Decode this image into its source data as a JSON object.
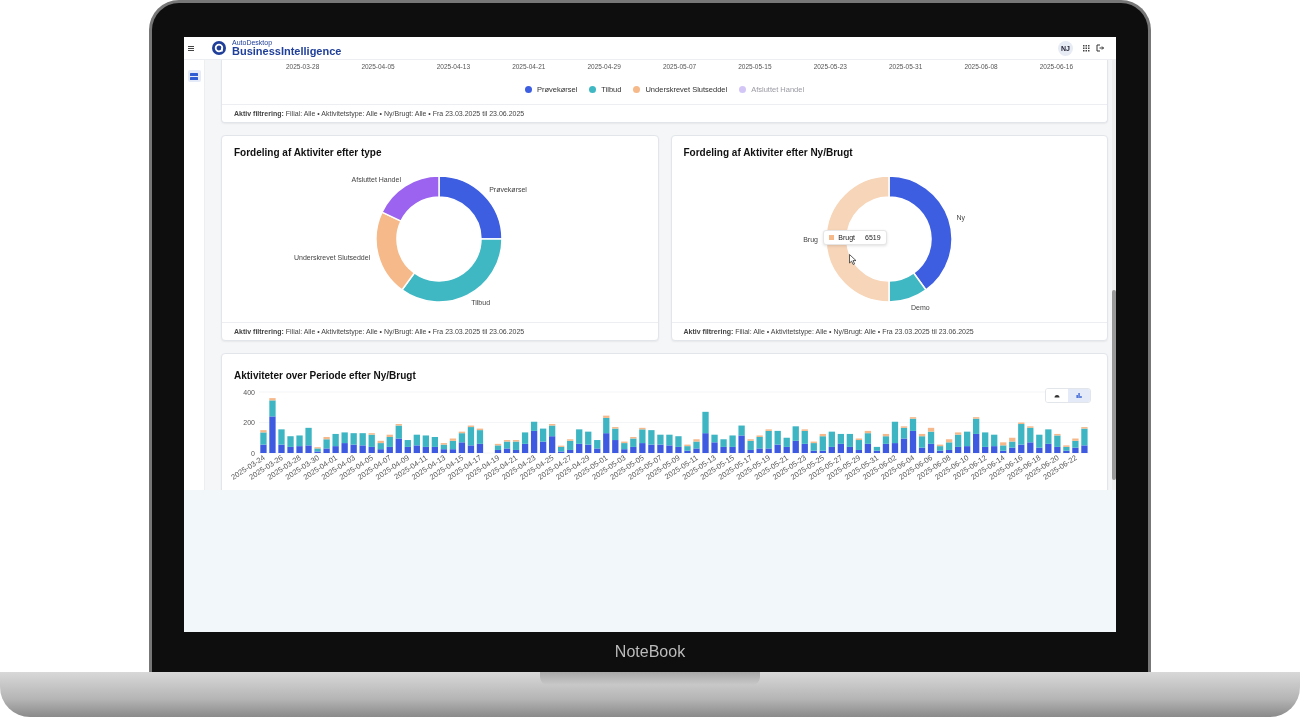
{
  "device": {
    "brand": "NoteBook"
  },
  "header": {
    "app_subtitle": "AutoDesktop",
    "app_title": "BusinessIntelligence",
    "user_initials": "NJ"
  },
  "sidebar": {
    "items": [
      {
        "kind": "dashboard",
        "selected": true
      }
    ]
  },
  "timeline_card": {
    "axis_labels": [
      "2025-03-28",
      "2025-04-05",
      "2025-04-13",
      "2025-04-21",
      "2025-04-29",
      "2025-05-07",
      "2025-05-15",
      "2025-05-23",
      "2025-05-31",
      "2025-06-08",
      "2025-06-16"
    ],
    "legend": [
      {
        "label": "Prøvekørsel",
        "color": "#3d5ee0",
        "hidden": false
      },
      {
        "label": "Tilbud",
        "color": "#3fb8c4",
        "hidden": false
      },
      {
        "label": "Underskrevet Slutseddel",
        "color": "#f5b98a",
        "hidden": false
      },
      {
        "label": "Afsluttet Handel",
        "color": "#d3c6f7",
        "hidden": true
      }
    ],
    "filter": "**Aktiv filtrering:** Filial: Alle • Aktivitetstype: Alle • Ny/Brugt: Alle • Fra 23.03.2025 til 23.06.2025"
  },
  "donut_cards": [
    {
      "title": "Fordeling af Aktiviter efter type",
      "chart_data": {
        "type": "donut",
        "categories": [
          "Prøvekørsel",
          "Tilbud",
          "Underskrevet Slutseddel",
          "Afsluttet Handel"
        ],
        "values": [
          25,
          35,
          22,
          18
        ],
        "colors": [
          "#3d5ee0",
          "#3fb8c4",
          "#f5b98a",
          "#9b63f0"
        ]
      },
      "filter": "**Aktiv filtrering:** Filial: Alle • Aktivitetstype: Alle • Ny/Brugt: Alle • Fra 23.03.2025 til 23.06.2025"
    },
    {
      "title": "Fordeling af Aktiviter efter Ny/Brugt",
      "chart_data": {
        "type": "donut",
        "categories": [
          "Ny",
          "Demo",
          "Brug"
        ],
        "values": [
          40,
          10,
          50
        ],
        "colors": [
          "#3d5ee0",
          "#3fb8c4",
          "#f7d5b8"
        ]
      },
      "tooltip": {
        "label": "Brugt",
        "value": "6519",
        "color": "#f5b98a"
      },
      "filter": "**Aktiv filtrering:** Filial: Alle • Aktivitetstype: Alle • Ny/Brugt: Alle • Fra 23.03.2025 til 23.06.2025"
    }
  ],
  "period_card": {
    "title": "Aktiviteter over Periode efter Ny/Brugt",
    "view_buttons": [
      {
        "kind": "pie",
        "selected": false
      },
      {
        "kind": "bar",
        "selected": true
      }
    ],
    "chart_data": {
      "type": "bar",
      "stacked": true,
      "ylim": [
        0,
        400
      ],
      "yticks": [
        0,
        200,
        400
      ],
      "categories": [
        "2025-03-24",
        null,
        "2025-03-26",
        null,
        "2025-03-28",
        null,
        "2025-03-30",
        null,
        "2025-04-01",
        null,
        "2025-04-03",
        null,
        "2025-04-05",
        null,
        "2025-04-07",
        null,
        "2025-04-09",
        null,
        "2025-04-11",
        null,
        "2025-04-13",
        null,
        "2025-04-15",
        null,
        "2025-04-17",
        null,
        "2025-04-19",
        null,
        "2025-04-21",
        null,
        "2025-04-23",
        null,
        "2025-04-25",
        null,
        "2025-04-27",
        null,
        "2025-04-29",
        null,
        "2025-05-01",
        null,
        "2025-05-03",
        null,
        "2025-05-05",
        null,
        "2025-05-07",
        null,
        "2025-05-09",
        null,
        "2025-05-11",
        null,
        "2025-05-13",
        null,
        "2025-05-15",
        null,
        "2025-05-17",
        null,
        "2025-05-19",
        null,
        "2025-05-21",
        null,
        "2025-05-23",
        null,
        "2025-05-25",
        null,
        "2025-05-27",
        null,
        "2025-05-29",
        null,
        "2025-05-31",
        null,
        "2025-06-02",
        null,
        "2025-06-04",
        null,
        "2025-06-06",
        null,
        "2025-06-08",
        null,
        "2025-06-10",
        null,
        "2025-06-12",
        null,
        "2025-06-14",
        null,
        "2025-06-16",
        null,
        "2025-06-18",
        null,
        "2025-06-20",
        null,
        "2025-06-22",
        null
      ],
      "series": [
        {
          "color": "#3d5ae0",
          "values": [
            55,
            240,
            55,
            40,
            45,
            50,
            10,
            30,
            45,
            65,
            55,
            50,
            40,
            25,
            40,
            95,
            40,
            50,
            40,
            40,
            25,
            25,
            70,
            50,
            60,
            1,
            20,
            30,
            20,
            60,
            145,
            75,
            110,
            10,
            20,
            60,
            55,
            30,
            130,
            85,
            25,
            40,
            65,
            55,
            55,
            50,
            40,
            15,
            30,
            130,
            70,
            40,
            40,
            115,
            20,
            30,
            30,
            55,
            40,
            80,
            60,
            15,
            15,
            40,
            60,
            40,
            20,
            60,
            15,
            60,
            65,
            95,
            145,
            35,
            60,
            15,
            20,
            40,
            45,
            125,
            40,
            45,
            15,
            35,
            55,
            70,
            35,
            60,
            40,
            15,
            35,
            50
          ]
        },
        {
          "color": "#3db5c3",
          "values": [
            80,
            105,
            100,
            70,
            70,
            115,
            20,
            60,
            80,
            70,
            75,
            80,
            80,
            40,
            65,
            85,
            45,
            70,
            75,
            65,
            30,
            55,
            60,
            120,
            90,
            3,
            30,
            45,
            55,
            75,
            60,
            85,
            70,
            30,
            60,
            95,
            85,
            55,
            100,
            75,
            40,
            55,
            90,
            95,
            65,
            70,
            70,
            30,
            45,
            140,
            50,
            50,
            75,
            65,
            60,
            75,
            115,
            90,
            60,
            95,
            85,
            50,
            95,
            100,
            65,
            85,
            65,
            70,
            25,
            50,
            140,
            70,
            80,
            75,
            80,
            30,
            50,
            80,
            95,
            100,
            95,
            75,
            35,
            40,
            135,
            95,
            85,
            95,
            75,
            25,
            45,
            110
          ]
        },
        {
          "color": "#f5b88a",
          "values": [
            15,
            15,
            5,
            2,
            5,
            5,
            8,
            15,
            5,
            5,
            5,
            2,
            10,
            15,
            15,
            10,
            5,
            5,
            5,
            5,
            10,
            15,
            10,
            10,
            10,
            3,
            10,
            10,
            10,
            5,
            5,
            5,
            10,
            8,
            10,
            5,
            5,
            3,
            15,
            10,
            10,
            10,
            10,
            5,
            5,
            5,
            5,
            10,
            15,
            5,
            5,
            5,
            5,
            5,
            10,
            10,
            10,
            5,
            5,
            5,
            10,
            10,
            15,
            0,
            5,
            0,
            10,
            15,
            0,
            15,
            5,
            10,
            10,
            15,
            25,
            10,
            20,
            15,
            5,
            10,
            5,
            5,
            20,
            25,
            10,
            10,
            5,
            5,
            10,
            10,
            15,
            10
          ]
        }
      ]
    }
  }
}
